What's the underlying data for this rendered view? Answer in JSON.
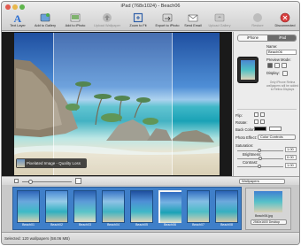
{
  "window": {
    "title": "iPad (768x1024) - Beach06"
  },
  "toolbar": {
    "text_layer": "Text Layer",
    "add_to_gallery": "Add to Gallery",
    "add_to_iphoto": "Add to iPhoto",
    "upload_wallpaper": "Upload Wallpaper",
    "zoom_to_fit": "Zoom to Fit",
    "export_to_iphoto": "Export to iPhoto",
    "send_email": "Send Email",
    "upload_gallery": "Upload Gallery",
    "restore": "Restore",
    "disconnected": "Disconnected"
  },
  "canvas": {
    "badge_text": "Pixelated Image - Quality Loss"
  },
  "panel": {
    "tabs": [
      "iPhone",
      "iPad"
    ],
    "name_label": "Name:",
    "name_value": "Beach06",
    "preview_mode_label": "Preview Mode:",
    "display_label": "Display:",
    "note": "Only iPhone Retina wallpapers will be added to Retina Displays",
    "flip_label": "Flip:",
    "rotate_label": "Rotate:",
    "back_color_label": "Back Color:",
    "photo_effect_label": "Photo Effect:",
    "photo_effect_value": "Color Controls",
    "saturation_label": "Saturation:",
    "saturation_value": "1.00",
    "brightness_label": "Brightness:",
    "brightness_value": "0.00",
    "contrast_label": "Contrast:",
    "contrast_value": "1.00"
  },
  "strip": {
    "category": "Wallpapers",
    "zoom_level": 0.15
  },
  "filmstrip": {
    "thumbs": [
      {
        "label": "Beach01"
      },
      {
        "label": "Beach02"
      },
      {
        "label": "Beach03"
      },
      {
        "label": "Beach04"
      },
      {
        "label": "Beach05"
      },
      {
        "label": "Beach06"
      },
      {
        "label": "Beach07"
      },
      {
        "label": "Beach08"
      }
    ],
    "selected_index": 5,
    "side_thumb_label": "Beach06.jpg",
    "side_thumb_size": "2560x1600 Desktop"
  },
  "status": {
    "text": "Selected: 120 wallpapers (58.06 MB)"
  },
  "colors": {
    "accent": "#3f7fc9",
    "close": "#e15a4f",
    "minimize": "#e8b74a",
    "zoom": "#5fb54d"
  }
}
